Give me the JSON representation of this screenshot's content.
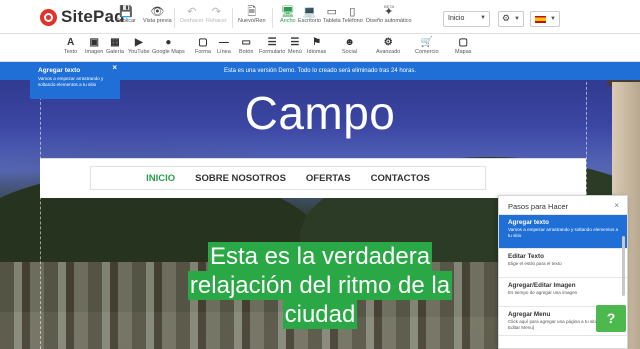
{
  "app": {
    "name": "SitePad"
  },
  "toolbar": {
    "publish": "Publicar",
    "preview": "Vista previa",
    "undo": "Deshacer",
    "redo": "Rehacer",
    "new_page": "Nuevo/Ren",
    "width": "Ancho",
    "desktop": "Escritorio",
    "tablet": "Tableta",
    "phone": "Teléfono",
    "auto_design": "Diseño automático",
    "beta": "BETA",
    "page_select": "Inicio"
  },
  "widgets": [
    "Texto",
    "Imagen",
    "Galería",
    "YouTube",
    "Google Maps",
    "Forma",
    "Línea",
    "Botón",
    "Formulario",
    "Menú",
    "Idiomas",
    "Social",
    "Avanzado",
    "Comercio",
    "Mapas"
  ],
  "demo_banner": "Esta es una versión Demo. Todo lo creado será eliminado tras 24 horas.",
  "tip": {
    "title": "Agregar texto",
    "desc": "Vamos a empezar arrastrando y soltando elementos a tu sitio",
    "close": "×"
  },
  "hero": {
    "title": "Campo",
    "nav": [
      "INICIO",
      "SOBRE NOSOTROS",
      "OFERTAS",
      "CONTACTOS"
    ],
    "lines": [
      "Esta es la verdadera",
      "relajación del ritmo de la",
      "ciudad"
    ]
  },
  "steps": {
    "title": "Pasos para Hacer",
    "close": "×",
    "items": [
      {
        "title": "Agregar texto",
        "desc": "Vamos a empezar arrastrando y soltando elementos a tu sitio"
      },
      {
        "title": "Editar Texto",
        "desc": "Elige el estilo para el texto"
      },
      {
        "title": "Agregar/Editar Imagen",
        "desc": "Es tiempo de agregar una imagen"
      },
      {
        "title": "Agregar Menu",
        "desc": "Click aquí para agregar una página a tu sitio (elige Editar Menu)"
      }
    ]
  },
  "help": "?",
  "colors": {
    "accent_green": "#2aa845",
    "banner_blue": "#1f6fd6",
    "logo_red": "#e4312b"
  }
}
